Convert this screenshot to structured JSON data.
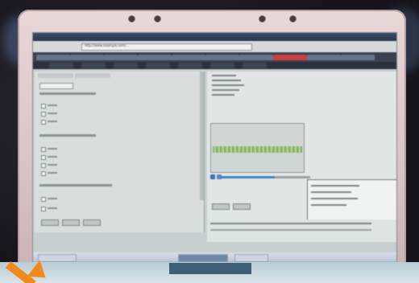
{
  "photo": {
    "subject": "Laptop screen"
  },
  "browser": {
    "address": "http://www.example.com/...",
    "tabs": [
      "tab-1",
      "tab-2",
      "tab-3",
      "tab-4",
      "tab-5",
      "tab-6",
      "tab-7",
      "tab-8"
    ],
    "active_tab_index": 7
  },
  "menu": {
    "items": [
      "item-1",
      "item-2",
      "item-3",
      "item-4",
      "item-5",
      "item-6",
      "item-7"
    ]
  },
  "left_panel": {
    "subtabs": [
      "Subtab 1",
      "Subtab 2"
    ],
    "question_1": "...",
    "question_2": "...",
    "question_3": "...",
    "options": [
      "...",
      "..."
    ],
    "buttons": [
      "...",
      "...",
      "..."
    ]
  },
  "right_panel": {
    "info_lines": [
      "...",
      "...",
      "...",
      "...",
      "..."
    ],
    "popup_lines": [
      "...",
      "...",
      "...",
      "..."
    ],
    "progress": 0.6
  },
  "taskbar": {
    "items": [
      "...",
      "...",
      "..."
    ]
  },
  "bottom": {
    "label": "..."
  },
  "colors": {
    "bezel": "#e0cccf",
    "arrow": "#f08a1d",
    "active_tab": "#c94040"
  }
}
